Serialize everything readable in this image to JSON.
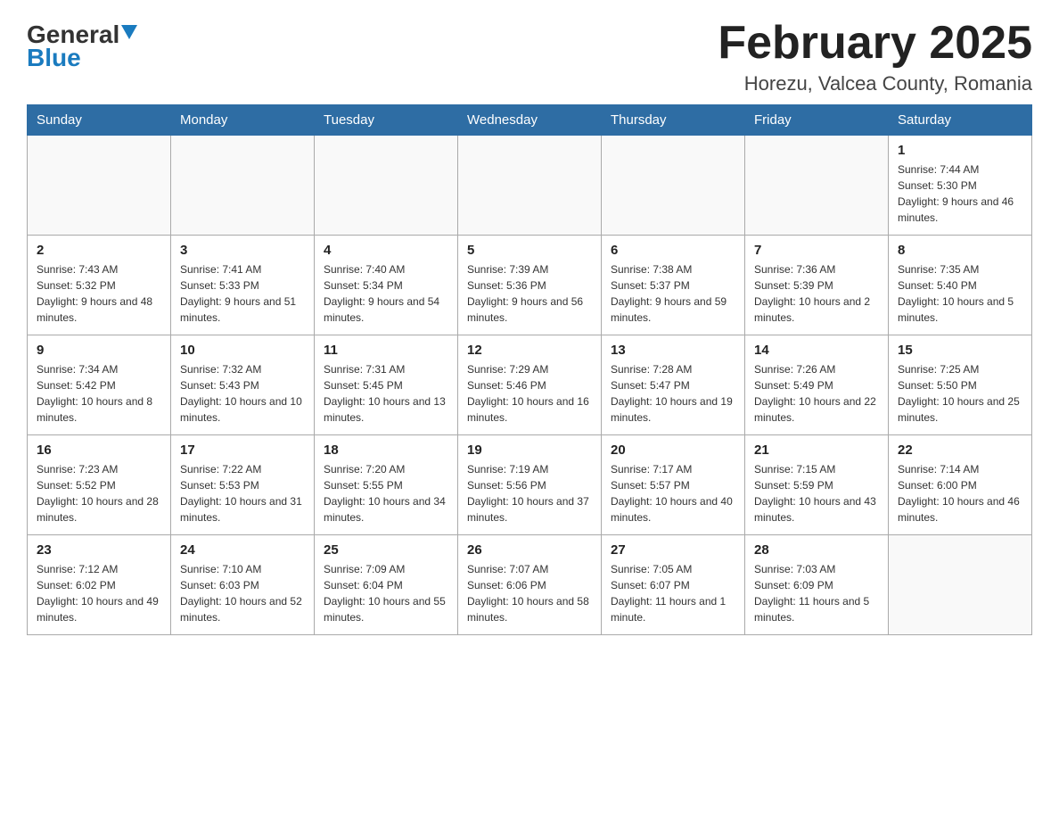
{
  "logo": {
    "line1": "General",
    "line2": "Blue"
  },
  "header": {
    "title": "February 2025",
    "subtitle": "Horezu, Valcea County, Romania"
  },
  "weekdays": [
    "Sunday",
    "Monday",
    "Tuesday",
    "Wednesday",
    "Thursday",
    "Friday",
    "Saturday"
  ],
  "weeks": [
    [
      {
        "day": "",
        "info": ""
      },
      {
        "day": "",
        "info": ""
      },
      {
        "day": "",
        "info": ""
      },
      {
        "day": "",
        "info": ""
      },
      {
        "day": "",
        "info": ""
      },
      {
        "day": "",
        "info": ""
      },
      {
        "day": "1",
        "info": "Sunrise: 7:44 AM\nSunset: 5:30 PM\nDaylight: 9 hours and 46 minutes."
      }
    ],
    [
      {
        "day": "2",
        "info": "Sunrise: 7:43 AM\nSunset: 5:32 PM\nDaylight: 9 hours and 48 minutes."
      },
      {
        "day": "3",
        "info": "Sunrise: 7:41 AM\nSunset: 5:33 PM\nDaylight: 9 hours and 51 minutes."
      },
      {
        "day": "4",
        "info": "Sunrise: 7:40 AM\nSunset: 5:34 PM\nDaylight: 9 hours and 54 minutes."
      },
      {
        "day": "5",
        "info": "Sunrise: 7:39 AM\nSunset: 5:36 PM\nDaylight: 9 hours and 56 minutes."
      },
      {
        "day": "6",
        "info": "Sunrise: 7:38 AM\nSunset: 5:37 PM\nDaylight: 9 hours and 59 minutes."
      },
      {
        "day": "7",
        "info": "Sunrise: 7:36 AM\nSunset: 5:39 PM\nDaylight: 10 hours and 2 minutes."
      },
      {
        "day": "8",
        "info": "Sunrise: 7:35 AM\nSunset: 5:40 PM\nDaylight: 10 hours and 5 minutes."
      }
    ],
    [
      {
        "day": "9",
        "info": "Sunrise: 7:34 AM\nSunset: 5:42 PM\nDaylight: 10 hours and 8 minutes."
      },
      {
        "day": "10",
        "info": "Sunrise: 7:32 AM\nSunset: 5:43 PM\nDaylight: 10 hours and 10 minutes."
      },
      {
        "day": "11",
        "info": "Sunrise: 7:31 AM\nSunset: 5:45 PM\nDaylight: 10 hours and 13 minutes."
      },
      {
        "day": "12",
        "info": "Sunrise: 7:29 AM\nSunset: 5:46 PM\nDaylight: 10 hours and 16 minutes."
      },
      {
        "day": "13",
        "info": "Sunrise: 7:28 AM\nSunset: 5:47 PM\nDaylight: 10 hours and 19 minutes."
      },
      {
        "day": "14",
        "info": "Sunrise: 7:26 AM\nSunset: 5:49 PM\nDaylight: 10 hours and 22 minutes."
      },
      {
        "day": "15",
        "info": "Sunrise: 7:25 AM\nSunset: 5:50 PM\nDaylight: 10 hours and 25 minutes."
      }
    ],
    [
      {
        "day": "16",
        "info": "Sunrise: 7:23 AM\nSunset: 5:52 PM\nDaylight: 10 hours and 28 minutes."
      },
      {
        "day": "17",
        "info": "Sunrise: 7:22 AM\nSunset: 5:53 PM\nDaylight: 10 hours and 31 minutes."
      },
      {
        "day": "18",
        "info": "Sunrise: 7:20 AM\nSunset: 5:55 PM\nDaylight: 10 hours and 34 minutes."
      },
      {
        "day": "19",
        "info": "Sunrise: 7:19 AM\nSunset: 5:56 PM\nDaylight: 10 hours and 37 minutes."
      },
      {
        "day": "20",
        "info": "Sunrise: 7:17 AM\nSunset: 5:57 PM\nDaylight: 10 hours and 40 minutes."
      },
      {
        "day": "21",
        "info": "Sunrise: 7:15 AM\nSunset: 5:59 PM\nDaylight: 10 hours and 43 minutes."
      },
      {
        "day": "22",
        "info": "Sunrise: 7:14 AM\nSunset: 6:00 PM\nDaylight: 10 hours and 46 minutes."
      }
    ],
    [
      {
        "day": "23",
        "info": "Sunrise: 7:12 AM\nSunset: 6:02 PM\nDaylight: 10 hours and 49 minutes."
      },
      {
        "day": "24",
        "info": "Sunrise: 7:10 AM\nSunset: 6:03 PM\nDaylight: 10 hours and 52 minutes."
      },
      {
        "day": "25",
        "info": "Sunrise: 7:09 AM\nSunset: 6:04 PM\nDaylight: 10 hours and 55 minutes."
      },
      {
        "day": "26",
        "info": "Sunrise: 7:07 AM\nSunset: 6:06 PM\nDaylight: 10 hours and 58 minutes."
      },
      {
        "day": "27",
        "info": "Sunrise: 7:05 AM\nSunset: 6:07 PM\nDaylight: 11 hours and 1 minute."
      },
      {
        "day": "28",
        "info": "Sunrise: 7:03 AM\nSunset: 6:09 PM\nDaylight: 11 hours and 5 minutes."
      },
      {
        "day": "",
        "info": ""
      }
    ]
  ]
}
